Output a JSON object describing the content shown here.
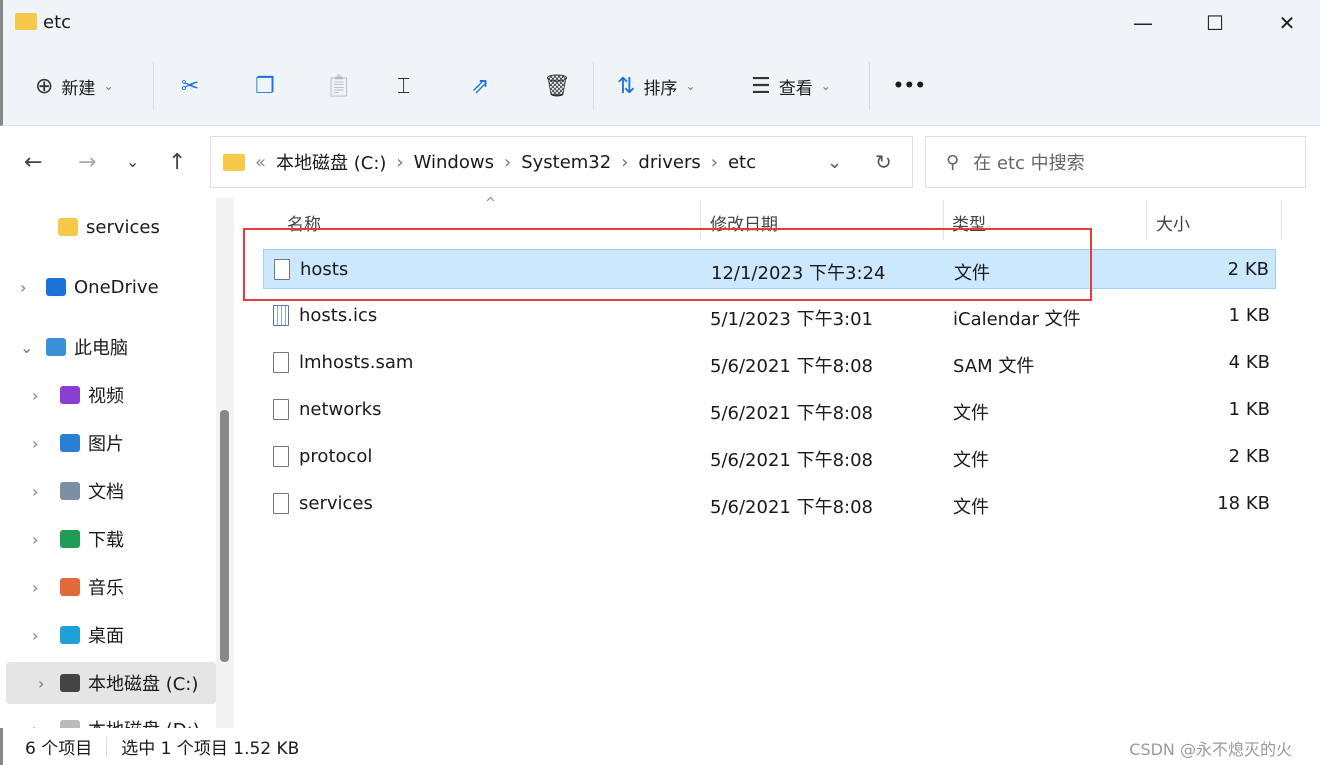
{
  "window": {
    "title": "etc",
    "minimize": "—",
    "maximize": "☐",
    "close": "✕"
  },
  "toolbar": {
    "new_label": "新建",
    "sort_label": "排序",
    "view_label": "查看",
    "more": "•••",
    "icons": [
      "cut-icon",
      "copy-icon",
      "paste-icon",
      "rename-icon",
      "share-icon",
      "delete-icon"
    ]
  },
  "nav": {
    "back": "←",
    "forward": "→",
    "recent": "⌄",
    "up": "↑"
  },
  "address": {
    "overflow": "«",
    "crumbs": [
      "本地磁盘 (C:)",
      "Windows",
      "System32",
      "drivers",
      "etc"
    ]
  },
  "search": {
    "placeholder": "在 etc 中搜索"
  },
  "sidebar": {
    "items": [
      {
        "label": "services",
        "icon": "folder-icon",
        "color": "#f7c94b",
        "expand": false
      },
      {
        "label": "OneDrive",
        "icon": "cloud-icon",
        "color": "#1a73d9",
        "expand": true
      },
      {
        "label": "此电脑",
        "icon": "computer-icon",
        "color": "#3a8fd9",
        "expand": true,
        "expanded": true
      },
      {
        "label": "视频",
        "icon": "video-icon",
        "color": "#8a3fd1",
        "expand": true
      },
      {
        "label": "图片",
        "icon": "pictures-icon",
        "color": "#2a7fd4",
        "expand": true
      },
      {
        "label": "文档",
        "icon": "documents-icon",
        "color": "#7d8fa3",
        "expand": true
      },
      {
        "label": "下载",
        "icon": "download-icon",
        "color": "#1f9d55",
        "expand": true
      },
      {
        "label": "音乐",
        "icon": "music-icon",
        "color": "#e06a3a",
        "expand": true
      },
      {
        "label": "桌面",
        "icon": "desktop-icon",
        "color": "#1fa0d9",
        "expand": true
      },
      {
        "label": "本地磁盘 (C:)",
        "icon": "drive-icon",
        "color": "#444444",
        "expand": true,
        "selected": true
      },
      {
        "label": "本地磁盘 (D:)",
        "icon": "drive-icon",
        "color": "#bbbbbb",
        "expand": true
      }
    ]
  },
  "columns": [
    "名称",
    "修改日期",
    "类型",
    "大小"
  ],
  "files": [
    {
      "name": "hosts",
      "date": "12/1/2023 下午3:24",
      "type": "文件",
      "size": "2 KB",
      "selected": true
    },
    {
      "name": "hosts.ics",
      "date": "5/1/2023 下午3:01",
      "type": "iCalendar 文件",
      "size": "1 KB"
    },
    {
      "name": "lmhosts.sam",
      "date": "5/6/2021 下午8:08",
      "type": "SAM 文件",
      "size": "4 KB"
    },
    {
      "name": "networks",
      "date": "5/6/2021 下午8:08",
      "type": "文件",
      "size": "1 KB"
    },
    {
      "name": "protocol",
      "date": "5/6/2021 下午8:08",
      "type": "文件",
      "size": "2 KB"
    },
    {
      "name": "services",
      "date": "5/6/2021 下午8:08",
      "type": "文件",
      "size": "18 KB"
    }
  ],
  "status": {
    "count": "6 个项目",
    "selection": "选中 1 个项目  1.52 KB"
  },
  "watermark": "CSDN @永不熄灭的火",
  "colors": {
    "selection": "#cce8ff",
    "highlight_box": "#e83b3b",
    "accent": "#0067c0"
  }
}
